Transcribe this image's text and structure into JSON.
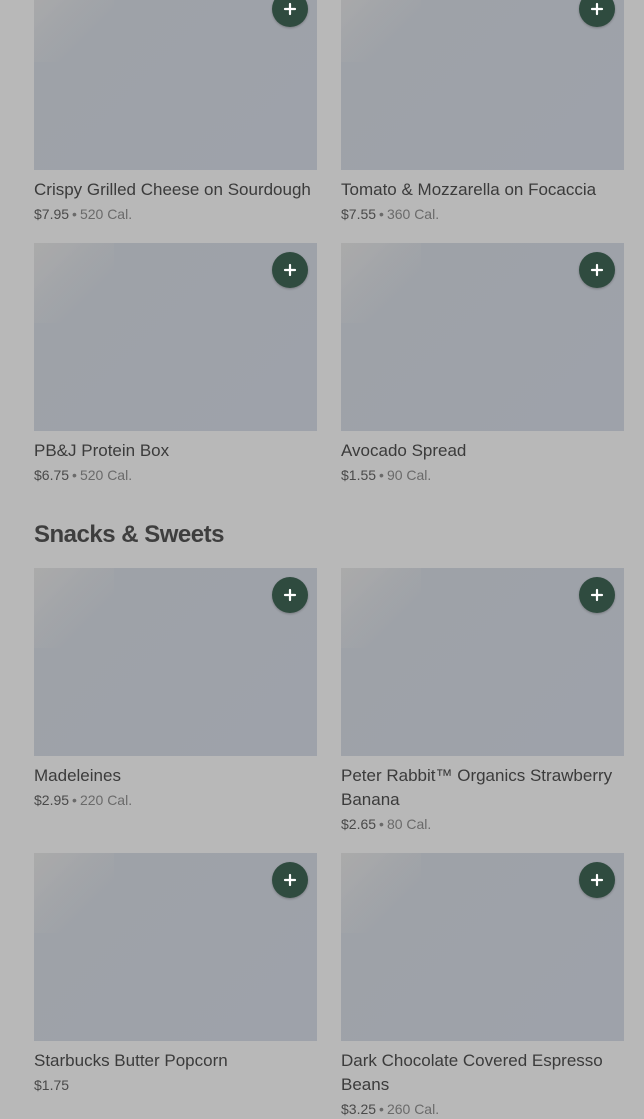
{
  "sections": [
    {
      "items": [
        {
          "name": "Crispy Grilled Cheese on Sourdough",
          "price": "$7.95",
          "calories": "520 Cal."
        },
        {
          "name": "Tomato & Mozzarella on Focaccia",
          "price": "$7.55",
          "calories": "360 Cal."
        },
        {
          "name": "PB&J Protein Box",
          "price": "$6.75",
          "calories": "520 Cal."
        },
        {
          "name": "Avocado Spread",
          "price": "$1.55",
          "calories": "90 Cal."
        }
      ]
    },
    {
      "heading": "Snacks & Sweets",
      "items": [
        {
          "name": "Madeleines",
          "price": "$2.95",
          "calories": "220 Cal."
        },
        {
          "name": "Peter Rabbit™ Organics Strawberry Banana",
          "price": "$2.65",
          "calories": "80 Cal."
        },
        {
          "name": "Starbucks Butter Popcorn",
          "price": "$1.75",
          "calories": ""
        },
        {
          "name": "Dark Chocolate Covered Espresso Beans",
          "price": "$3.25",
          "calories": "260 Cal."
        }
      ]
    }
  ],
  "icons": {
    "add": "plus-icon"
  },
  "colors": {
    "add_button": "#2f4b3f",
    "background": "#b8b8b8",
    "thumbnail": "#9ea2a8"
  }
}
